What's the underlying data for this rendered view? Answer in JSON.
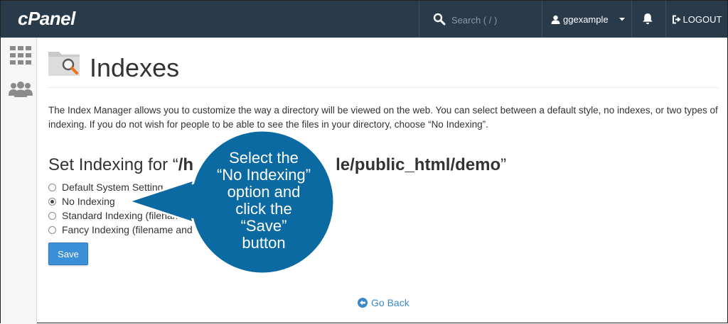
{
  "brand": {
    "logo_text": "cPanel"
  },
  "header": {
    "search_placeholder": "Search ( / )",
    "username": "ggexample",
    "logout_label": "LOGOUT"
  },
  "page": {
    "title": "Indexes",
    "description": "The Index Manager allows you to customize the way a directory will be viewed on the web. You can select between a default style, no indexes, or two types of indexing. If you do not wish for people to be able to see the files in your directory, choose “No Indexing”.",
    "section_prefix": "Set Indexing for “",
    "section_path_start": "/h",
    "section_path_end": "le/public_html/demo",
    "section_suffix": "”",
    "options": [
      {
        "label": "Default System Setting",
        "checked": false
      },
      {
        "label": "No Indexing",
        "checked": true
      },
      {
        "label": "Standard Indexing (filename",
        "checked": false
      },
      {
        "label": "Fancy Indexing (filename and",
        "checked": false
      }
    ],
    "save_label": "Save",
    "go_back_label": "Go Back"
  },
  "callout": {
    "lines": [
      "Select the",
      "“No Indexing”",
      "option and",
      "click the",
      "“Save”",
      "button"
    ]
  },
  "colors": {
    "topbar": "#293a4a",
    "callout": "#0a6aa1",
    "primary_button": "#3b8fd9",
    "link": "#3a87c8"
  }
}
